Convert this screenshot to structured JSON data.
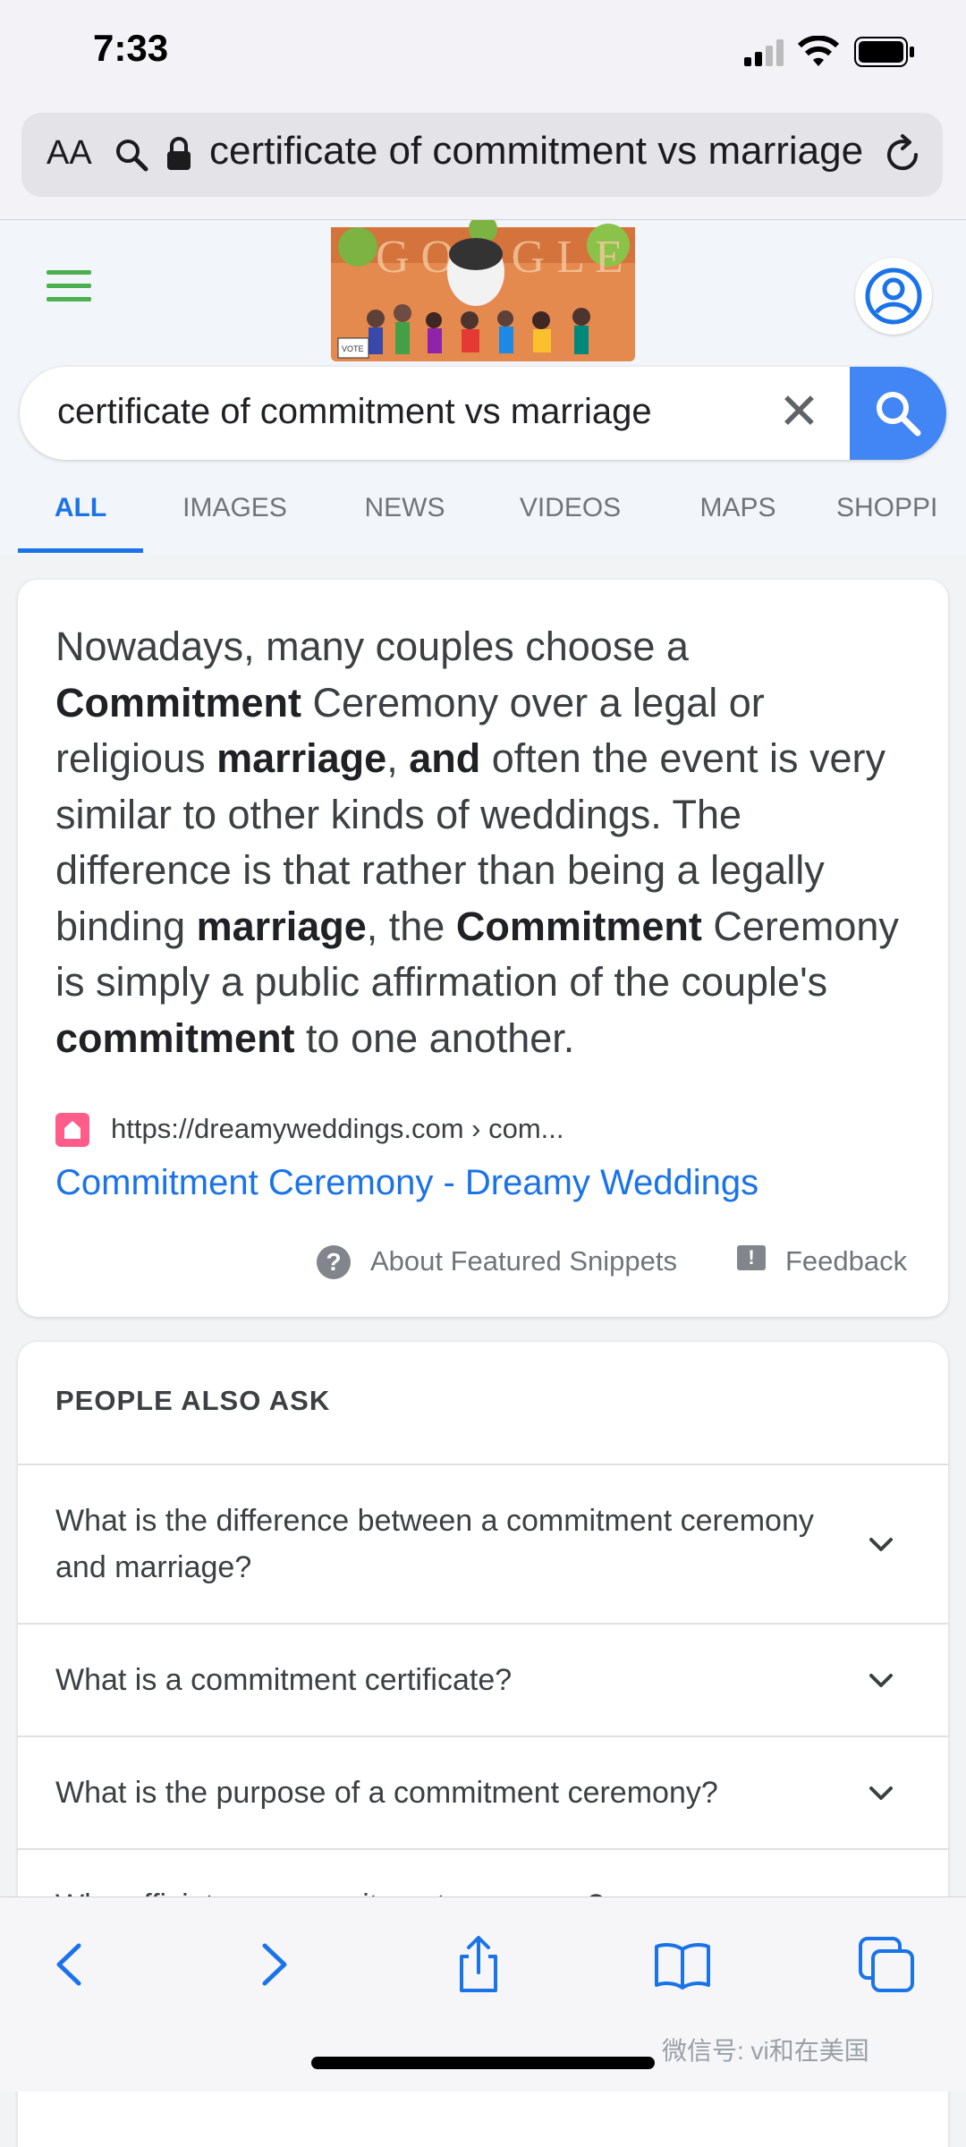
{
  "status_bar": {
    "time": "7:33"
  },
  "url_bar": {
    "aa_label": "AA",
    "url_text": "certificate of commitment vs marriage"
  },
  "search": {
    "query": "certificate of commitment vs marriage"
  },
  "tabs": [
    "ALL",
    "IMAGES",
    "NEWS",
    "VIDEOS",
    "MAPS",
    "SHOPPI"
  ],
  "snippet": {
    "source_url": "https://dreamyweddings.com › com...",
    "source_title": "Commitment Ceremony - Dreamy Weddings",
    "about_label": "About Featured Snippets",
    "feedback_label": "Feedback"
  },
  "paa": {
    "title": "PEOPLE ALSO ASK",
    "questions": [
      "What is the difference between a commitment ceremony and marriage?",
      "What is a commitment certificate?",
      "What is the purpose of a commitment ceremony?",
      "Who officiates a commitment ceremony?"
    ]
  },
  "watermark": "微信号: vi和在美国",
  "colors": {
    "google_blue": "#4285f4",
    "link_blue": "#1a73e8",
    "menu_green": "#4caf50"
  },
  "icons": [
    "search-icon",
    "lock-icon",
    "reload-icon",
    "menu-icon",
    "account-icon",
    "clear-icon",
    "back-icon",
    "forward-icon",
    "share-icon",
    "bookmarks-icon",
    "tabs-icon"
  ]
}
